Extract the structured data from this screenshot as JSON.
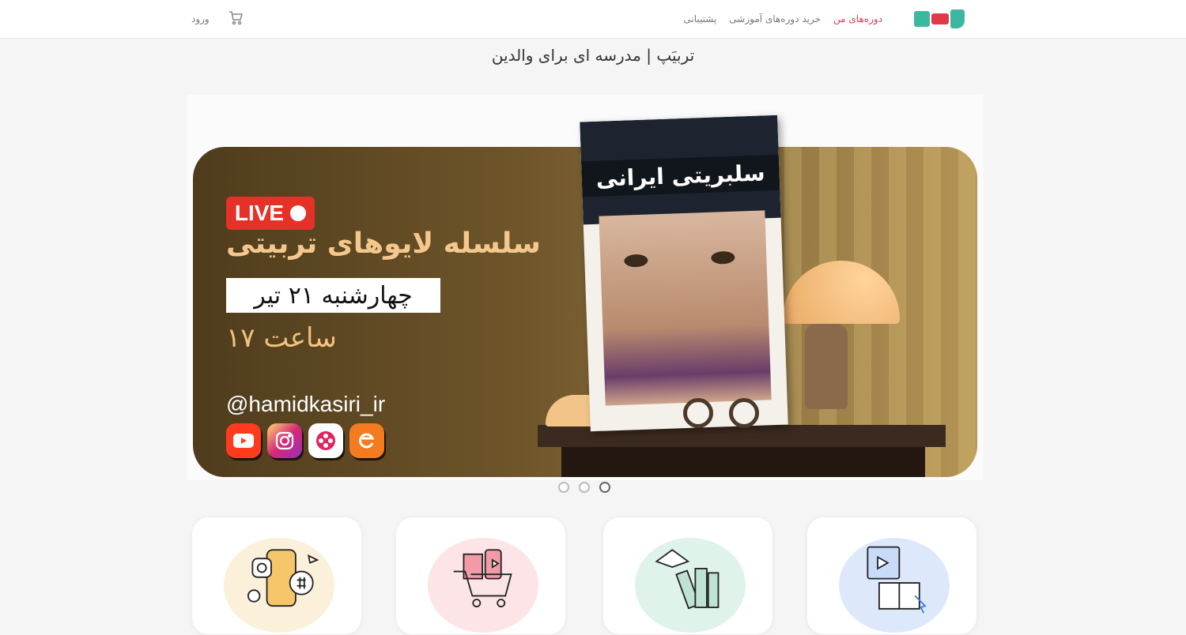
{
  "header": {
    "logo_name": "logo-icon",
    "nav": [
      {
        "label": "دوره‌های من",
        "active": true
      },
      {
        "label": "خرید دوره‌های آموزشی",
        "active": false
      },
      {
        "label": "پشتیبانی",
        "active": false
      }
    ],
    "login_label": "ورود",
    "cart_icon": "cart-icon"
  },
  "site_title": "تربیَپ | مدرسه ای برای والدین",
  "banner": {
    "live_label": "LIVE",
    "headline": "سلسله لایوهای تربیتی",
    "date_text": "چهارشنبه ۲۱ تیر",
    "time_text": "ساعت ۱۷",
    "handle": "@hamidkasiri_ir",
    "book_title": "سلبریتی ایرانی",
    "socials": [
      "youtube-icon",
      "instagram-icon",
      "aparat-icon",
      "eitaa-icon"
    ]
  },
  "carousel": {
    "count": 3,
    "active_index": 2
  },
  "cards": [
    {
      "name": "social-media-card",
      "blob_color": "#fbf0d9"
    },
    {
      "name": "shopping-card",
      "blob_color": "#fde4e6"
    },
    {
      "name": "books-card",
      "blob_color": "#dff3ea"
    },
    {
      "name": "video-learning-card",
      "blob_color": "#dde9fb"
    }
  ],
  "colors": {
    "accent": "#e1384a",
    "brand_green": "#3cb8a1",
    "live_red": "#e53128"
  }
}
